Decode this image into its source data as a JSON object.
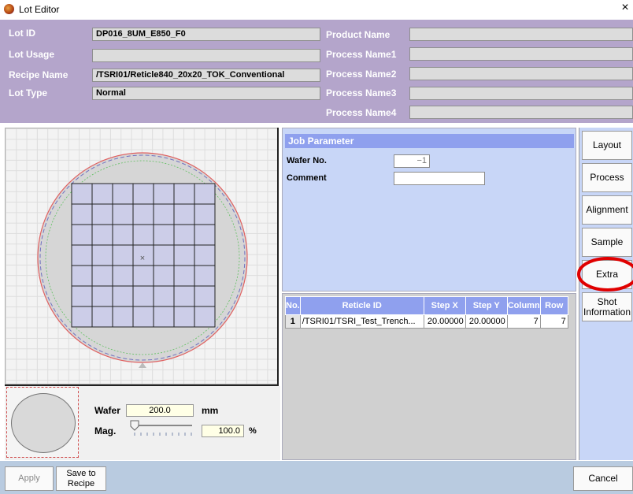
{
  "window": {
    "title": "Lot Editor",
    "close_label": "×"
  },
  "header": {
    "lot_id_label": "Lot ID",
    "lot_id_value": "DP016_8UM_E850_F0",
    "lot_usage_label": "Lot Usage",
    "lot_usage_value": "",
    "recipe_name_label": "Recipe Name",
    "recipe_name_value": "/TSRI01/Reticle840_20x20_TOK_Conventional",
    "lot_type_label": "Lot Type",
    "lot_type_value": "Normal",
    "product_name_label": "Product Name",
    "product_name_value": "",
    "process_name1_label": "Process Name1",
    "process_name1_value": "",
    "process_name2_label": "Process Name2",
    "process_name2_value": "",
    "process_name3_label": "Process Name3",
    "process_name3_value": "",
    "process_name4_label": "Process Name4",
    "process_name4_value": ""
  },
  "wafer_map": {
    "columns": 7,
    "rows": 7,
    "center_mark": "×"
  },
  "wafer_settings": {
    "wafer_label": "Wafer",
    "wafer_value": "200.0",
    "wafer_unit": "mm",
    "mag_label": "Mag.",
    "mag_value": "100.0",
    "mag_unit": "%"
  },
  "job_parameter": {
    "title": "Job Parameter",
    "wafer_no_label": "Wafer No.",
    "wafer_no_value": "−1",
    "comment_label": "Comment",
    "comment_value": ""
  },
  "reticle_table": {
    "headers": [
      "No.",
      "Reticle ID",
      "Step X",
      "Step Y",
      "Column",
      "Row"
    ],
    "rows": [
      [
        "1",
        "/TSRI01/TSRI_Test_Trench...",
        "20.00000",
        "20.00000",
        "7",
        "7"
      ]
    ]
  },
  "side_buttons": {
    "layout": "Layout",
    "process": "Process",
    "alignment": "Alignment",
    "sample": "Sample",
    "extra": "Extra",
    "shot_information": "Shot Information"
  },
  "bottom": {
    "apply": "Apply",
    "save_to_recipe": "Save to Recipe",
    "cancel": "Cancel"
  },
  "colors": {
    "header_bg": "#b4a5cb",
    "job_bg": "#c8d6f7",
    "table_header": "#8fa0ee",
    "annotation": "#e00000",
    "bottom_bar": "#b9cbe0"
  }
}
